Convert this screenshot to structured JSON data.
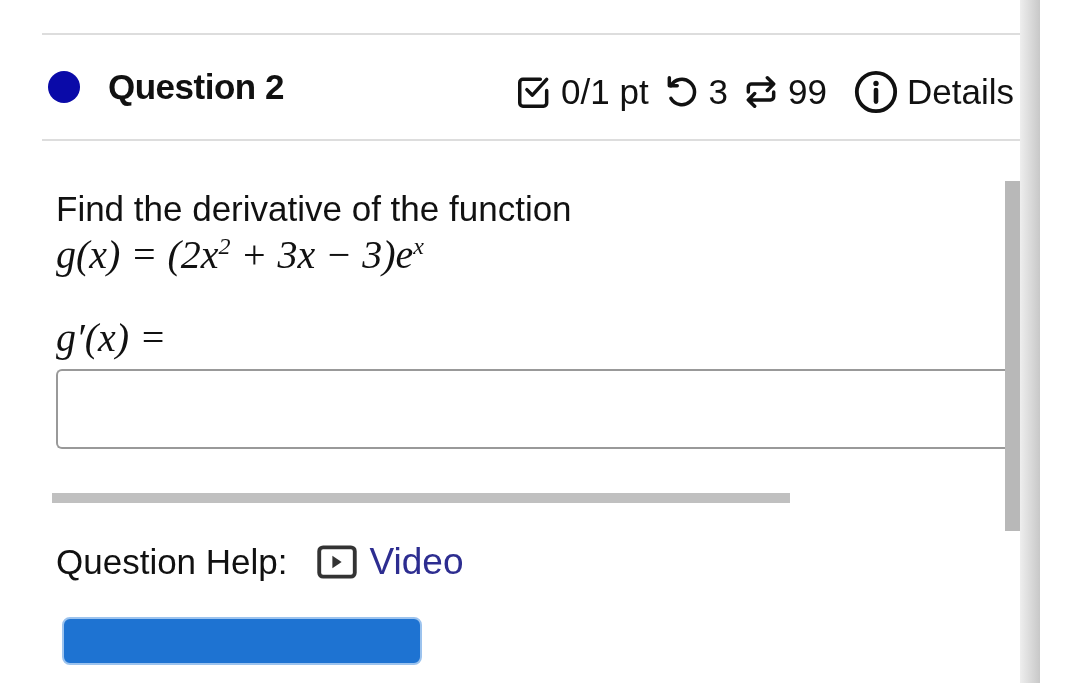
{
  "question": {
    "title": "Question 2",
    "score": "0/1 pt",
    "retries": "3",
    "attempts": "99",
    "details": "Details"
  },
  "prompt": "Find the derivative of the function",
  "formula": "g(x) = (2x$^{2}$ + 3x − 3)e$^{x}$",
  "answer_label": "g′(x) =",
  "help": {
    "label": "Question Help:",
    "link": "Video"
  }
}
